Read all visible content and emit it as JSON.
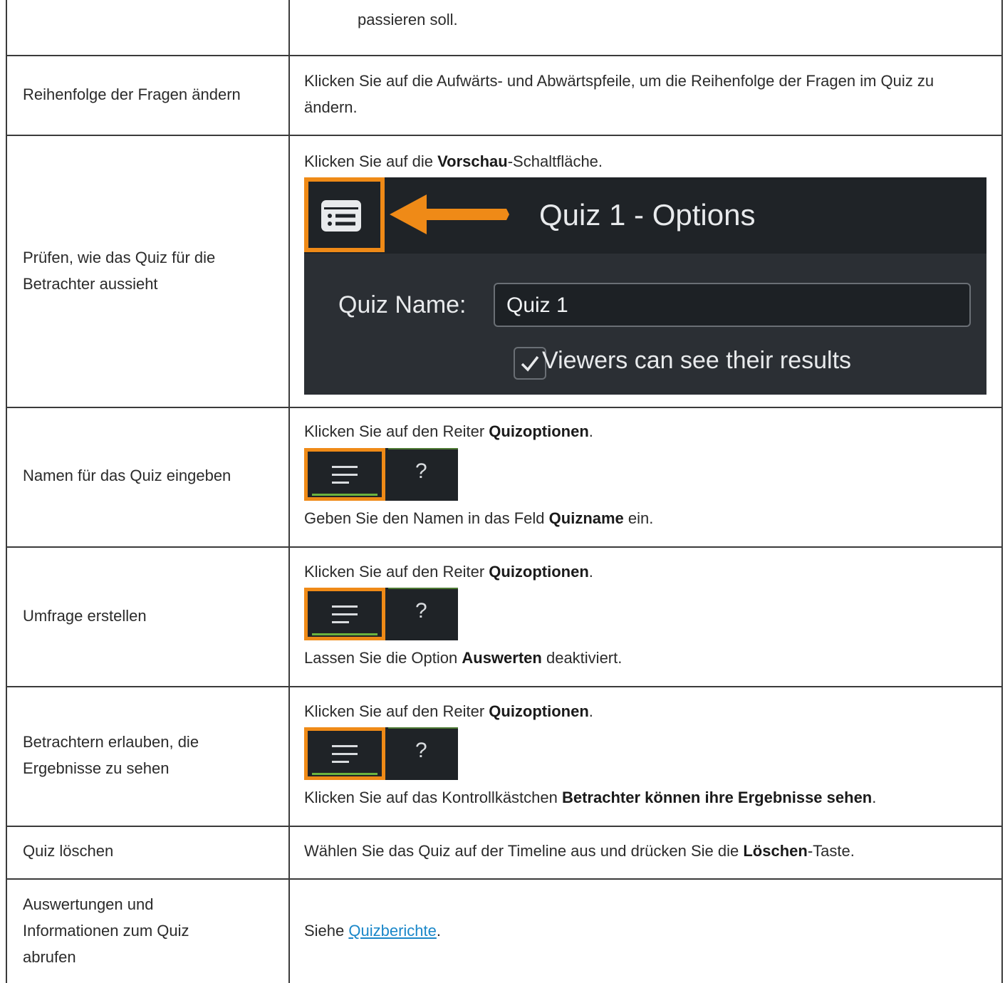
{
  "rows": [
    {
      "label": "",
      "desc": "passieren soll."
    },
    {
      "label": "Reihenfolge der Fragen ändern",
      "desc": "Klicken Sie auf die Aufwärts- und Abwärtspfeile, um die Reihenfolge der Fragen im Quiz zu ändern."
    },
    {
      "label": "Prüfen, wie das Quiz für die Betrachter aussieht",
      "desc_pre": "Klicken Sie auf die ",
      "desc_bold": "Vorschau",
      "desc_post": "-Schaltfläche."
    },
    {
      "label": "Namen für das Quiz eingeben",
      "desc_pre": "Klicken Sie auf den Reiter ",
      "desc_bold": "Quizoptionen",
      "desc_post": ".",
      "desc2_pre": "Geben Sie den Namen in das Feld ",
      "desc2_bold": "Quizname",
      "desc2_post": " ein."
    },
    {
      "label": "Umfrage erstellen",
      "desc_pre": "Klicken Sie auf den Reiter ",
      "desc_bold": "Quizoptionen",
      "desc_post": ".",
      "desc2_pre": "Lassen Sie die Option ",
      "desc2_bold": "Auswerten",
      "desc2_post": " deaktiviert."
    },
    {
      "label": "Betrachtern erlauben, die Ergebnisse zu sehen",
      "desc_pre": "Klicken Sie auf den Reiter ",
      "desc_bold": "Quizoptionen",
      "desc_post": ".",
      "desc2_pre": "Klicken Sie auf das Kontrollkästchen ",
      "desc2_bold": "Betrachter können ihre Ergebnisse sehen",
      "desc2_post": "."
    },
    {
      "label": "Quiz löschen",
      "desc_pre": "Wählen Sie das Quiz auf der Timeline aus und drücken Sie die ",
      "desc_bold": "Löschen",
      "desc_post": "-Taste."
    },
    {
      "label": "Auswertungen und Informationen zum Quiz abrufen",
      "desc_pre": "Siehe ",
      "desc_link": "Quizberichte",
      "desc_post": "."
    }
  ],
  "screenshot": {
    "title": "Quiz 1 - Options",
    "name_label": "Quiz Name:",
    "name_value": "Quiz 1",
    "checkbox_label": "Viewers can see their results",
    "highlight_color": "#ef8a17"
  },
  "tabs": {
    "help_glyph": "?"
  }
}
